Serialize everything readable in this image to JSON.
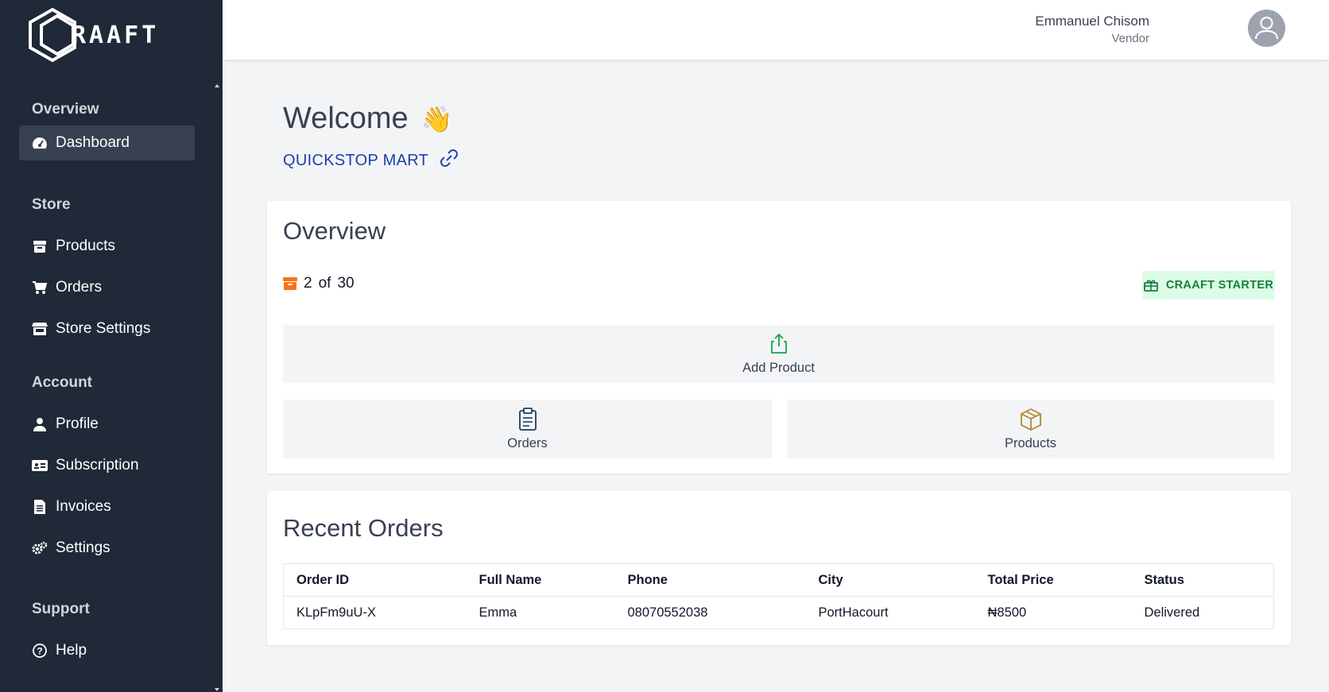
{
  "brand": {
    "name": "RAAFT"
  },
  "sidebar": {
    "sections": [
      {
        "title": "Overview",
        "items": [
          {
            "label": "Dashboard",
            "icon": "gauge-icon",
            "active": true
          }
        ]
      },
      {
        "title": "Store",
        "items": [
          {
            "label": "Products",
            "icon": "box-icon"
          },
          {
            "label": "Orders",
            "icon": "cart-icon"
          },
          {
            "label": "Store Settings",
            "icon": "store-icon"
          }
        ]
      },
      {
        "title": "Account",
        "items": [
          {
            "label": "Profile",
            "icon": "user-icon"
          },
          {
            "label": "Subscription",
            "icon": "id-card-icon"
          },
          {
            "label": "Invoices",
            "icon": "invoice-icon"
          },
          {
            "label": "Settings",
            "icon": "gears-icon"
          }
        ]
      },
      {
        "title": "Support",
        "items": [
          {
            "label": "Help",
            "icon": "help-icon"
          }
        ]
      }
    ]
  },
  "header": {
    "user_name": "Emmanuel Chisom",
    "user_role": "Vendor"
  },
  "welcome": {
    "title": "Welcome",
    "emoji": "👋",
    "store_name": "QUICKSTOP MART"
  },
  "overview": {
    "title": "Overview",
    "product_count": "2",
    "of_label": "of",
    "product_limit": "30",
    "plan": "CRAAFT STARTER",
    "add_product_label": "Add Product",
    "orders_label": "Orders",
    "products_label": "Products"
  },
  "recent_orders": {
    "title": "Recent Orders",
    "columns": [
      "Order ID",
      "Full Name",
      "Phone",
      "City",
      "Total Price",
      "Status"
    ],
    "rows": [
      [
        "KLpFm9uU-X",
        "Emma",
        "08070552038",
        "PortHacourt",
        "₦8500",
        "Delivered"
      ]
    ]
  },
  "colors": {
    "sidebar_bg": "#1f2937",
    "link": "#1e40af",
    "badge_bg": "#dcfce7",
    "badge_text": "#15803d",
    "count_icon": "#f97316"
  }
}
